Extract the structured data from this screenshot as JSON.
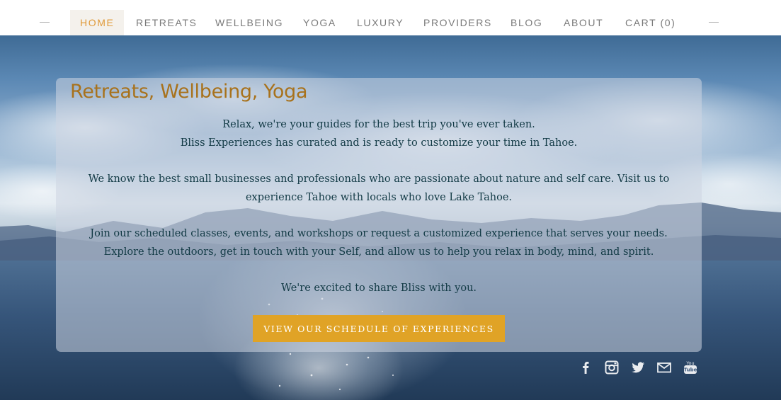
{
  "nav": {
    "items": [
      {
        "label": "HOME",
        "active": true
      },
      {
        "label": "RETREATS",
        "active": false
      },
      {
        "label": "WELLBEING",
        "active": false
      },
      {
        "label": "YOGA",
        "active": false
      },
      {
        "label": "LUXURY",
        "active": false
      },
      {
        "label": "PROVIDERS",
        "active": false
      },
      {
        "label": "BLOG",
        "active": false
      },
      {
        "label": "ABOUT",
        "active": false
      },
      {
        "label": "CART (0)",
        "active": false
      }
    ]
  },
  "panel": {
    "title": "Retreats, Wellbeing, Yoga",
    "paragraphs": [
      {
        "lines": [
          "Relax, we're your guides for the best trip you've ever taken.",
          "Bliss Experiences has curated and is ready to customize your time in Tahoe."
        ]
      },
      {
        "lines": [
          "We know the best small businesses and professionals who are passionate about nature and self care. Visit us to",
          "experience Tahoe with locals who love Lake Tahoe."
        ]
      },
      {
        "lines": [
          "Join our scheduled classes, events, and workshops or request a customized experience that serves your needs.",
          "Explore the outdoors, get in touch with your Self, and allow us to help you relax in body, mind, and spirit."
        ]
      },
      {
        "lines": [
          "We're excited to share Bliss with you."
        ]
      }
    ],
    "cta_label": "VIEW OUR SCHEDULE OF EXPERIENCES"
  },
  "social": {
    "icons": [
      "facebook-icon",
      "instagram-icon",
      "twitter-icon",
      "email-icon",
      "youtube-icon"
    ]
  },
  "colors": {
    "accent": "#e09a3a",
    "title": "#a8721c",
    "button": "#e0a326",
    "body_text": "#123a45"
  }
}
